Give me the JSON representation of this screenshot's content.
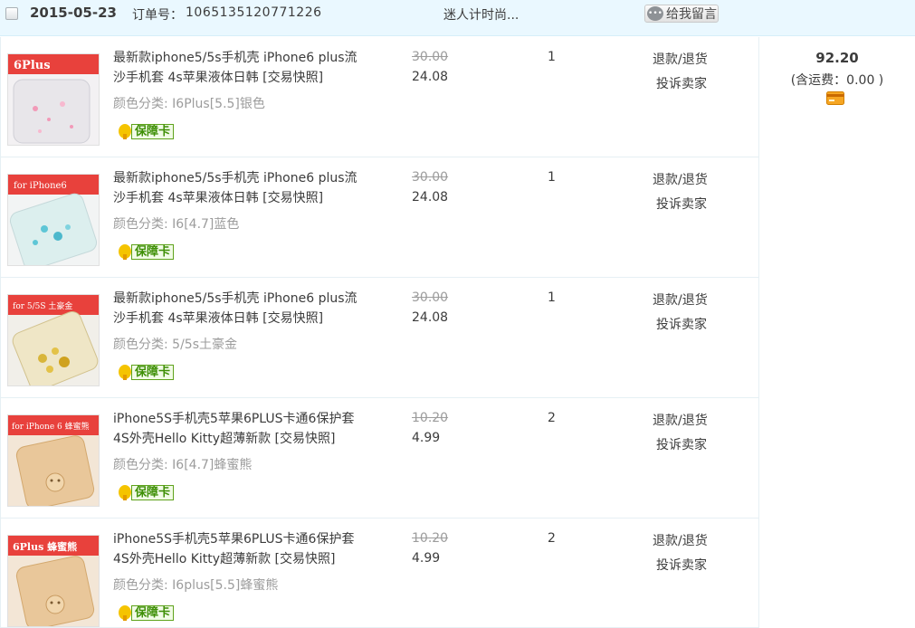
{
  "order": {
    "date": "2015-05-23",
    "order_no_label": "订单号：",
    "order_no": "1065135120771226",
    "shop_name": "迷人计时尚...",
    "message_button": "给我留言",
    "message_icon": "speech-bubble-icon"
  },
  "items": [
    {
      "title": "最新款iphone5/5s手机壳 iPhone6 plus流沙手机套 4s苹果液体日韩 [交易快照]",
      "spec": "颜色分类: I6Plus[5.5]银色",
      "badge": "保障卡",
      "price_original": "30.00",
      "price_current": "24.08",
      "quantity": "1",
      "refund_label": "退款/退货",
      "complain_label": "投诉卖家",
      "thumb_text": "6Plus",
      "thumb_accent": "#e8e6ea"
    },
    {
      "title": "最新款iphone5/5s手机壳 iPhone6 plus流沙手机套 4s苹果液体日韩 [交易快照]",
      "spec": "颜色分类: I6[4.7]蓝色",
      "badge": "保障卡",
      "price_original": "30.00",
      "price_current": "24.08",
      "quantity": "1",
      "refund_label": "退款/退货",
      "complain_label": "投诉卖家",
      "thumb_text": "for iPhone6",
      "thumb_accent": "#5ec6d6"
    },
    {
      "title": "最新款iphone5/5s手机壳 iPhone6 plus流沙手机套 4s苹果液体日韩 [交易快照]",
      "spec": "颜色分类: 5/5s土豪金",
      "badge": "保障卡",
      "price_original": "30.00",
      "price_current": "24.08",
      "quantity": "1",
      "refund_label": "退款/退货",
      "complain_label": "投诉卖家",
      "thumb_text": "for 5/5S 土豪金",
      "thumb_accent": "#d8b53a"
    },
    {
      "title": "iPhone5S手机壳5苹果6PLUS卡通6保护套4S外壳Hello Kitty超薄新款 [交易快照]",
      "spec": "颜色分类: I6[4.7]蜂蜜熊",
      "badge": "保障卡",
      "price_original": "10.20",
      "price_current": "4.99",
      "quantity": "2",
      "refund_label": "退款/退货",
      "complain_label": "投诉卖家",
      "thumb_text": "for iPhone 6 蜂蜜熊",
      "thumb_accent": "#e9c79a"
    },
    {
      "title": "iPhone5S手机壳5苹果6PLUS卡通6保护套4S外壳Hello Kitty超薄新款 [交易快照]",
      "spec": "颜色分类: I6plus[5.5]蜂蜜熊",
      "badge": "保障卡",
      "price_original": "10.20",
      "price_current": "4.99",
      "quantity": "2",
      "refund_label": "退款/退货",
      "complain_label": "投诉卖家",
      "thumb_text": "6Plus 蜂蜜熊",
      "thumb_accent": "#e9c79a"
    }
  ],
  "totals": {
    "amount": "92.20",
    "shipping": "(含运费：0.00 )",
    "payment_icon": "bank-card-icon"
  },
  "colors": {
    "header_bg": "#eaf8ff",
    "thumb_banner": "#e8413c",
    "badge_green": "#5fa31c",
    "strike_gray": "#9c9c9c"
  }
}
